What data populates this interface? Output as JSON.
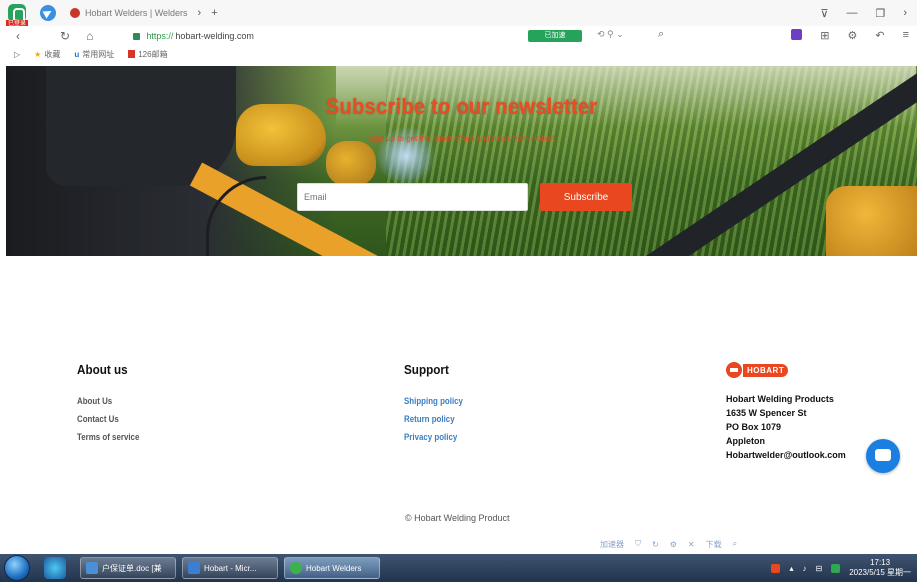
{
  "browser": {
    "app_badge": "已登录",
    "tab": {
      "title": "Hobart Welders | Welders"
    },
    "url": {
      "scheme": "https://",
      "host": "hobart-welding.com"
    },
    "green_button": "已加速",
    "bookmarks": [
      "收藏",
      "常用网址",
      "126邮箱"
    ]
  },
  "newsletter": {
    "title": "Subscribe to our newsletter",
    "subtitle": "Sign up to get the latest offers and news from Hobart",
    "email_placeholder": "Email",
    "subscribe_label": "Subscribe"
  },
  "footer": {
    "about": {
      "title": "About us",
      "links": [
        "About Us",
        "Contact Us",
        "Terms of service"
      ]
    },
    "support": {
      "title": "Support",
      "links": [
        "Shipping policy",
        "Return policy",
        "Privacy policy"
      ]
    },
    "company": {
      "logo_text": "HOBART",
      "name": "Hobart Welding Products",
      "street": "1635 W Spencer St",
      "po_box": "PO Box 1079",
      "city": "Appleton",
      "email": "Hobartwelder@outlook.com"
    },
    "copyright": "© Hobart Welding Product"
  },
  "statusbar": {
    "items": [
      "加速器",
      "下载"
    ]
  },
  "taskbar": {
    "tasks": [
      {
        "label": "户保证单.doc [兼",
        "color": "#4b8fd6"
      },
      {
        "label": "Hobart - Micr...",
        "color": "#3c7fd0"
      },
      {
        "label": "Hobart Welders",
        "color": "#3cb34a"
      }
    ],
    "time": "17:13",
    "date": "2023/5/15 星期一"
  },
  "colors": {
    "accent": "#e8471f",
    "link": "#3a7fc2",
    "chat": "#1a7fe0"
  }
}
